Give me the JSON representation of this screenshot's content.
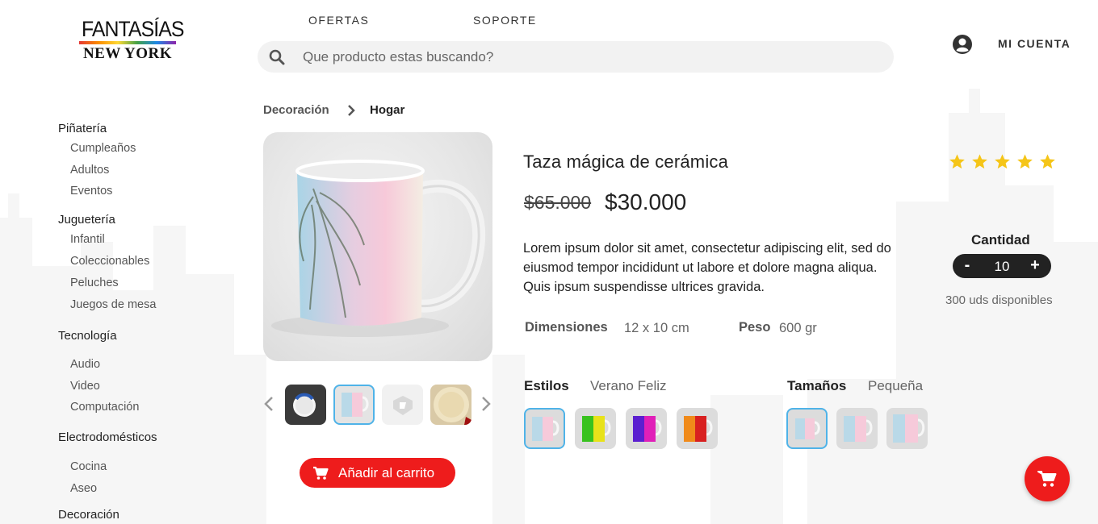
{
  "brand": {
    "top": "FANTASÍAS",
    "bottom": "NEW YORK"
  },
  "nav": {
    "offers": "OFERTAS",
    "support": "SOPORTE",
    "account": "MI CUENTA"
  },
  "search": {
    "placeholder": "Que producto estas buscando?",
    "value": ""
  },
  "sidebar": [
    {
      "label": "Piñatería",
      "items": [
        "Cumpleaños",
        "Adultos",
        "Eventos"
      ]
    },
    {
      "label": "Juguetería",
      "items": [
        "Infantil",
        "Coleccionables",
        "Peluches",
        "Juegos de mesa"
      ]
    },
    {
      "label": "Tecnología",
      "items": [
        "Audio",
        "Video",
        "Computación"
      ]
    },
    {
      "label": "Electrodomésticos",
      "items": [
        "Cocina",
        "Aseo"
      ]
    },
    {
      "label": "Decoración",
      "items": []
    }
  ],
  "breadcrumb": [
    "Decoración",
    "Hogar"
  ],
  "product": {
    "title": "Taza mágica de cerámica",
    "old_price": "$65.000",
    "price": "$30.000",
    "description": "Lorem ipsum dolor sit amet, consectetur adipiscing elit, sed do eiusmod tempor incididunt ut labore et dolore magna aliqua. Quis ipsum suspendisse ultrices gravida.",
    "specs": [
      {
        "label": "Dimensiones",
        "value": "12 x 10 cm"
      },
      {
        "label": "Peso",
        "value": "600 gr"
      }
    ],
    "styles": {
      "label": "Estilos",
      "selected": "Verano Feliz"
    },
    "sizes": {
      "label": "Tamaños",
      "selected": "Pequeña"
    },
    "add_to_cart": "Añadir al carrito",
    "rating": 5,
    "quantity_label": "Cantidad",
    "quantity": "10",
    "stock": "300 uds disponibles"
  },
  "stepper": {
    "minus": "-",
    "plus": "+"
  },
  "colors": {
    "accent": "#ee1c1c",
    "selection": "#4fb3e8",
    "star": "#f5c518"
  },
  "icons": [
    "search-icon",
    "account-icon",
    "chevron-right-icon",
    "chevron-left-icon",
    "cart-icon",
    "star-icon"
  ]
}
